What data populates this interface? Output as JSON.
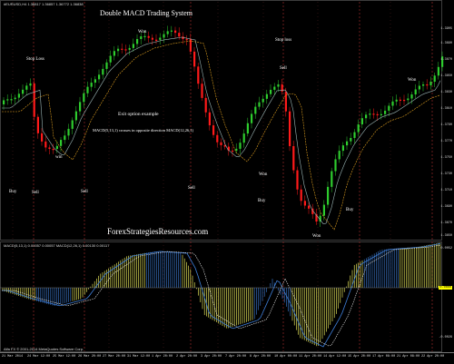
{
  "window": {
    "symbol_info": "#EURUSD,H4 1.36817 1.36857 1.36772 1.36838",
    "macd_info": "MACD(5,13,1) 0.00057 0.00057 MACD(12,26,1) 0.00130 0.00117",
    "copyright": "Alfa FX © 2001-2014 MetaQuotes Software Corp."
  },
  "overlay": {
    "title": "Double MACD Trading System",
    "exit_header": "Exit option example",
    "exit_desc": "MACD(5,13,1) crosses in opposite direction MACD(12,26,1)",
    "watermark": "ForexStrategiesResources.com"
  },
  "signals": [
    {
      "text": "Stop Loss"
    },
    {
      "text": "Won"
    },
    {
      "text": "Stop loss"
    },
    {
      "text": "Sell"
    },
    {
      "text": "Won"
    },
    {
      "text": "win"
    },
    {
      "text": "Won"
    },
    {
      "text": "Buy"
    },
    {
      "text": "Sell"
    },
    {
      "text": "Sell"
    },
    {
      "text": "Sell"
    },
    {
      "text": "Buy"
    },
    {
      "text": "Buy"
    },
    {
      "text": "Won"
    }
  ],
  "price_axis": [
    "1.3905",
    "1.3890",
    "1.3870",
    "1.3850",
    "1.3830",
    "1.3810",
    "1.3790",
    "1.3770",
    "1.3750",
    "1.3730",
    "1.3710",
    "1.3690",
    "1.3670",
    "1.3650"
  ],
  "macd_axis": [
    "0.0052",
    "0.0000",
    "-0.0026"
  ],
  "time_axis": [
    "21 Mar 2014",
    "24 Mar 12:00",
    "25 Mar 12:00",
    "26 Mar 20:00",
    "27 Mar 20:00",
    "31 Mar 12:00",
    "1 Apr 20:00",
    "2 Apr 20:00",
    "3 Apr 20:00",
    "7 Apr 20:00",
    "8 Apr 20:00",
    "10 Apr 00:00",
    "11 Apr 20:00",
    "14 Apr 12:00",
    "15 Apr 20:00",
    "17 Apr 08:00",
    "21 Apr 08:00",
    "22 Apr 20:00"
  ],
  "colors": {
    "bull": "#2ecc2e",
    "bear": "#ff1a1a",
    "ma_fast": "#9bb5b5",
    "ma_slow": "#e0a020",
    "hist_yellow": "#ffff66",
    "hist_blue": "#3f7fd8",
    "vline": "#b03030"
  }
}
